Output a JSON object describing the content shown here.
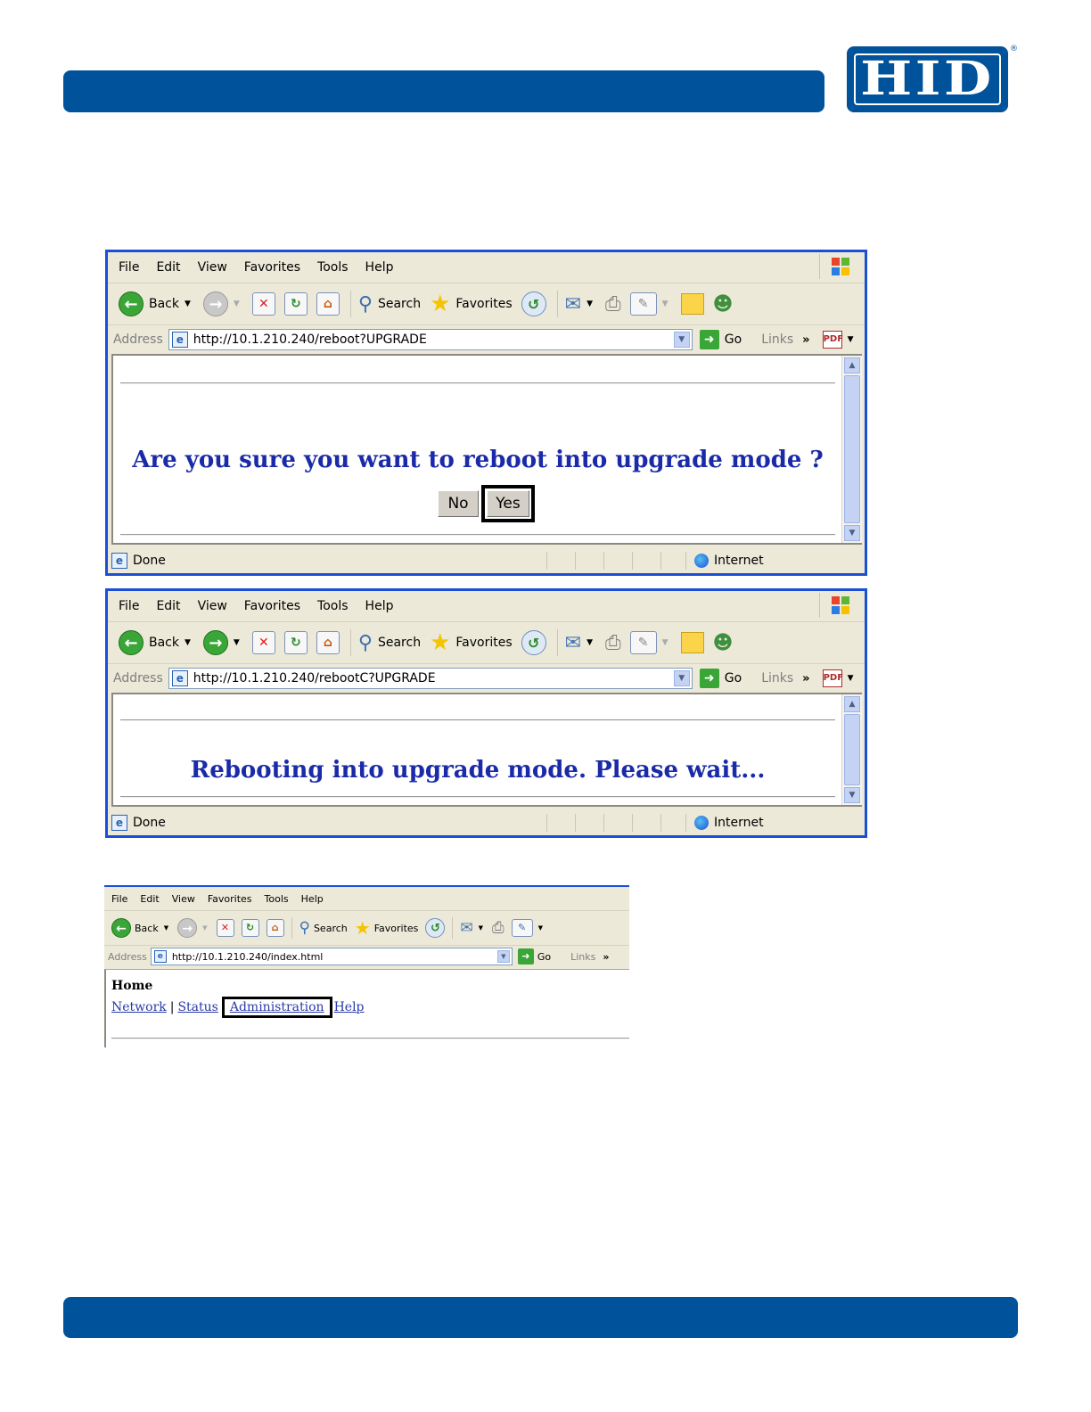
{
  "header": {
    "logo_text": "HID",
    "logo_registered": "®"
  },
  "browser1": {
    "menu": [
      "File",
      "Edit",
      "View",
      "Favorites",
      "Tools",
      "Help"
    ],
    "toolbar": {
      "back": "Back",
      "search": "Search",
      "favorites": "Favorites"
    },
    "address_label": "Address",
    "url": "http://10.1.210.240/reboot?UPGRADE",
    "go": "Go",
    "links": "Links",
    "chevrons": "»",
    "question": "Are you sure you want to reboot into upgrade mode ?",
    "no_button": "No",
    "yes_button": "Yes",
    "status": "Done",
    "zone": "Internet"
  },
  "browser2": {
    "menu": [
      "File",
      "Edit",
      "View",
      "Favorites",
      "Tools",
      "Help"
    ],
    "toolbar": {
      "back": "Back",
      "search": "Search",
      "favorites": "Favorites"
    },
    "address_label": "Address",
    "url": "http://10.1.210.240/rebootC?UPGRADE",
    "go": "Go",
    "links": "Links",
    "chevrons": "»",
    "message": "Rebooting into upgrade mode. Please wait...",
    "status": "Done",
    "zone": "Internet"
  },
  "browser3": {
    "menu": [
      "File",
      "Edit",
      "View",
      "Favorites",
      "Tools",
      "Help"
    ],
    "toolbar": {
      "back": "Back",
      "search": "Search",
      "favorites": "Favorites"
    },
    "address_label": "Address",
    "url": "http://10.1.210.240/index.html",
    "go": "Go",
    "links": "Links",
    "chevrons": "»",
    "home": "Home",
    "nav": [
      "Network",
      "Status",
      "Administration",
      "Help"
    ],
    "nav_sep": "|"
  },
  "colors": {
    "brand_blue": "#00529b",
    "ie_border": "#1a4fd6",
    "message_blue": "#1a2aa8"
  }
}
